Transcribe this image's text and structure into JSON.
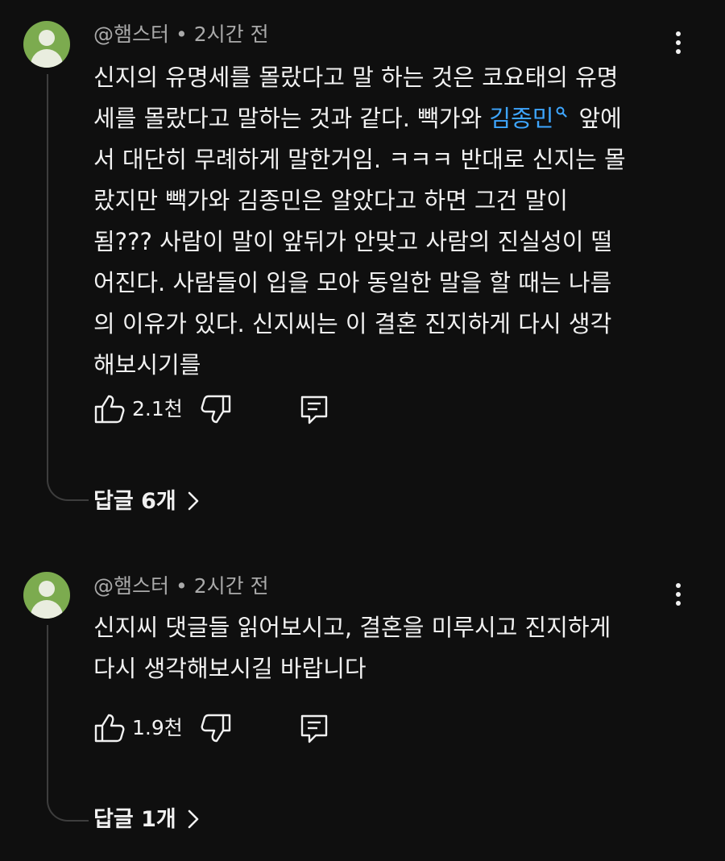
{
  "comments": [
    {
      "author": "@햄스터",
      "separator": "•",
      "time": "2시간 전",
      "lines": [
        "신지의 유명세를 몰랐다고 말 하는 것은 코요태의 유명",
        "세를 몰랐다고 말하는 것과 같다. 빽가와",
        "서 대단히 무례하게 말한거임. ㅋㅋㅋ 반대로 신지는 몰",
        "랐지만 빽가와 김종민은 알았다고 하면 그건 말이",
        "됨??? 사람이 말이 앞뒤가 안맞고 사람의 진실성이 떨",
        "어진다. 사람들이 입을 모아 동일한 말을 할 때는 나름",
        "의 이유가 있다. 신지씨는 이 결혼 진지하게 다시 생각",
        "해보시기를"
      ],
      "mention": "김종민",
      "mention_after": "앞에",
      "mention_icon": "search-icon",
      "like_count": "2.1천",
      "replies_label": "답글 6개"
    },
    {
      "author": "@햄스터",
      "separator": "•",
      "time": "2시간 전",
      "lines": [
        "신지씨 댓글들 읽어보시고, 결혼을 미루시고 진지하게",
        "다시 생각해보시길 바랍니다"
      ],
      "like_count": "1.9천",
      "replies_label": "답글 1개"
    }
  ],
  "colors": {
    "background": "#0f0f0f",
    "text": "#f1f1f1",
    "meta": "#aaaaaa",
    "mention": "#3ea6ff",
    "avatar": "#7cab4f",
    "thread_line": "#3d3d3d"
  },
  "icons": [
    "avatar-icon",
    "more-vert-icon",
    "thumb-up-icon",
    "thumb-down-icon",
    "reply-icon",
    "chevron-right-icon",
    "search-icon"
  ]
}
